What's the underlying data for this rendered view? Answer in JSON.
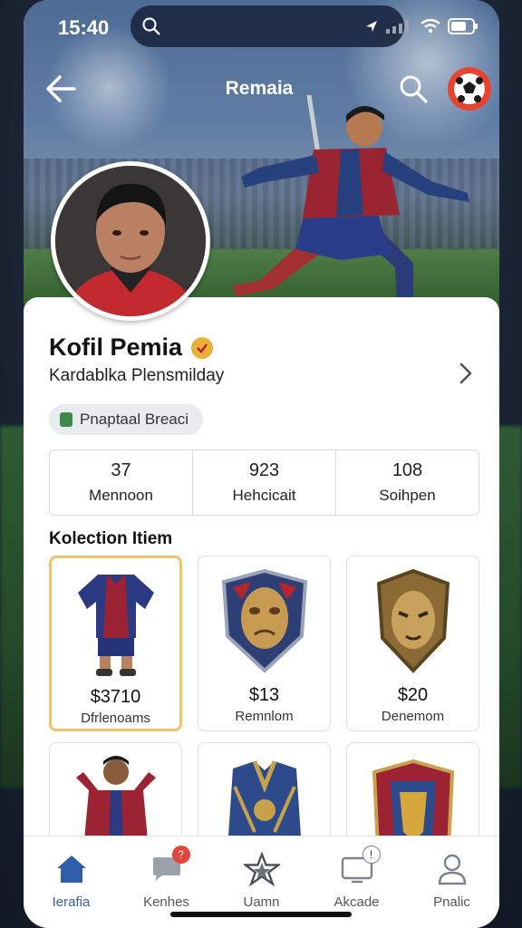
{
  "status": {
    "time": "15:40"
  },
  "nav": {
    "title": "Remaia"
  },
  "profile": {
    "name": "Kofil Pemia",
    "subtitle": "Kardablka Plensmilday",
    "tag": "Pnaptaal Breaci"
  },
  "stats": [
    {
      "value": "37",
      "label": "Mennoon"
    },
    {
      "value": "923",
      "label": "Hehcicait"
    },
    {
      "value": "108",
      "label": "Soihpen"
    }
  ],
  "collection": {
    "title": "Kolection Itiem",
    "items": [
      {
        "price": "$3710",
        "name": "Dfrlenoams"
      },
      {
        "price": "$13",
        "name": "Remnlom"
      },
      {
        "price": "$20",
        "name": "Denemom"
      }
    ]
  },
  "tabs": [
    {
      "label": "Ierafia",
      "icon": "home-icon"
    },
    {
      "label": "Kenhes",
      "icon": "chat-icon",
      "badge": "?"
    },
    {
      "label": "Uamn",
      "icon": "star-icon"
    },
    {
      "label": "Akcade",
      "icon": "screen-icon",
      "badge": "!"
    },
    {
      "label": "Pnalic",
      "icon": "person-icon"
    }
  ],
  "colors": {
    "accent": "#2f5fa8",
    "brand_red": "#e7432f",
    "gold": "#efc46b"
  }
}
